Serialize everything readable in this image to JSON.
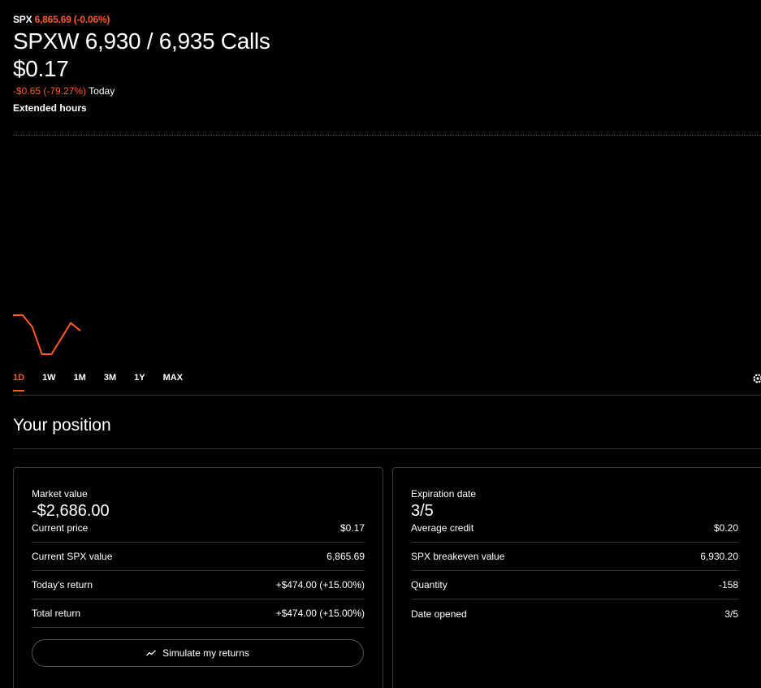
{
  "underlying": {
    "symbol": "SPX",
    "quote": "6,865.69 (-0.06%)"
  },
  "title": "SPXW 6,930 / 6,935 Calls",
  "price": "$0.17",
  "change": {
    "value": "-$0.65 (-79.27%)",
    "period": "Today"
  },
  "session": "Extended hours",
  "colors": {
    "accent": "#ff5a1f",
    "background": "#000000",
    "divider": "#333333"
  },
  "chart_data": {
    "type": "line",
    "x": [
      0,
      1,
      2,
      3,
      4,
      5,
      6,
      7
    ],
    "series": [
      {
        "values": [
          0.22,
          0.22,
          0.19,
          0.12,
          0.12,
          0.16,
          0.2,
          0.18
        ]
      }
    ]
  },
  "range_tabs": [
    {
      "label": "1D",
      "active": true
    },
    {
      "label": "1W",
      "active": false
    },
    {
      "label": "1M",
      "active": false
    },
    {
      "label": "3M",
      "active": false
    },
    {
      "label": "1Y",
      "active": false
    },
    {
      "label": "MAX",
      "active": false
    }
  ],
  "settings_icon": "gear-icon",
  "section_title": "Your position",
  "left_card": {
    "label": "Market value",
    "value": "-$2,686.00",
    "rows": [
      {
        "label": "Current price",
        "value": "$0.17"
      },
      {
        "label": "Current SPX value",
        "value": "6,865.69"
      },
      {
        "label": "Today's return",
        "value": "+$474.00 (+15.00%)"
      },
      {
        "label": "Total return",
        "value": "+$474.00 (+15.00%)"
      }
    ],
    "button": {
      "label": "Simulate my returns",
      "icon": "trend-line-icon"
    }
  },
  "right_card": {
    "label": "Expiration date",
    "value": "3/5",
    "rows": [
      {
        "label": "Average credit",
        "value": "$0.20"
      },
      {
        "label": "SPX breakeven value",
        "value": "6,930.20"
      },
      {
        "label": "Quantity",
        "value": "-158"
      },
      {
        "label": "Date opened",
        "value": "3/5"
      }
    ]
  }
}
